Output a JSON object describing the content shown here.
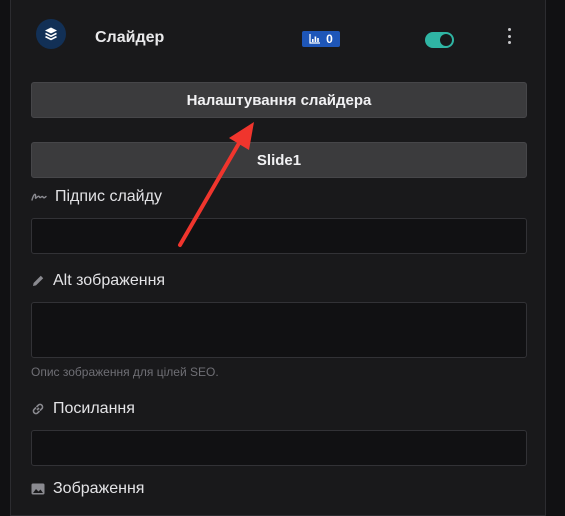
{
  "header": {
    "title": "Слайдер",
    "count": "0",
    "toggle_state": "on",
    "icons": {
      "layers": "layers-icon",
      "stats": "bar-chart-icon",
      "more": "vertical-dots-icon"
    }
  },
  "buttons": {
    "slider_settings": "Налаштування слайдера",
    "slide": "Slide1"
  },
  "fields": {
    "caption": {
      "label": "Підпис слайду",
      "value": "",
      "icon": "signature-icon"
    },
    "alt": {
      "label": "Alt зображення",
      "value": "",
      "icon": "pencil-icon",
      "hint": "Опис зображення для цілей SEO."
    },
    "link": {
      "label": "Посилання",
      "value": "",
      "icon": "link-icon"
    },
    "image": {
      "label": "Зображення",
      "icon": "image-icon"
    }
  },
  "colors": {
    "accent_teal": "#2fb5a4",
    "badge_blue": "#1e56b8",
    "annotation_red": "#f0352d"
  }
}
